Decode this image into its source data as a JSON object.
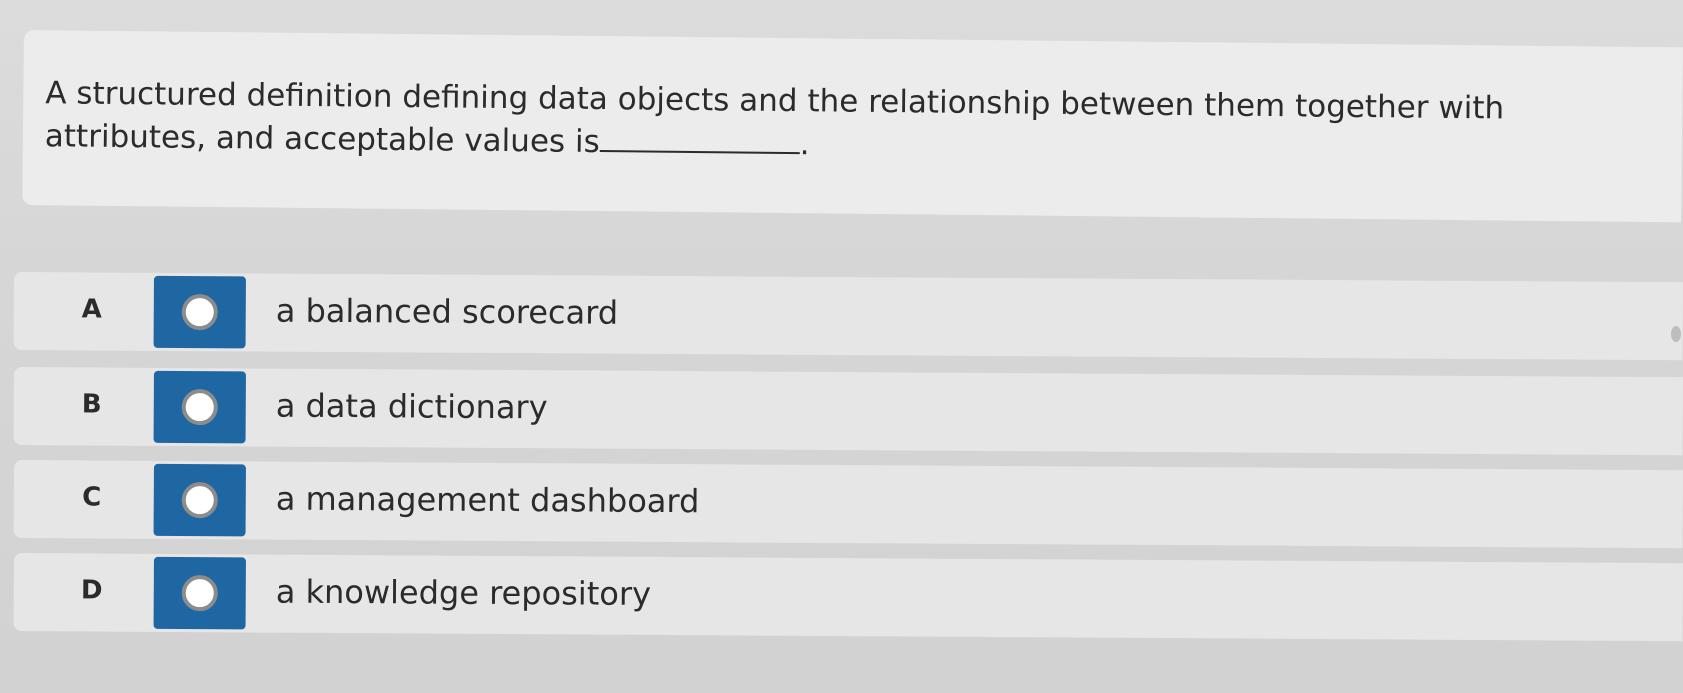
{
  "question": {
    "text": "A structured definition defining data objects and the relationship between them together with attributes, and acceptable values is",
    "suffix": "."
  },
  "options": [
    {
      "letter": "A",
      "text": "a balanced scorecard"
    },
    {
      "letter": "B",
      "text": "a data dictionary"
    },
    {
      "letter": "C",
      "text": "a management dashboard"
    },
    {
      "letter": "D",
      "text": "a knowledge repository"
    }
  ],
  "colors": {
    "radio_fill": "#1f67a3",
    "radio_ring": "#8c8c8c",
    "text": "#2b2b2b"
  },
  "icons": {
    "radio": "radio-unselected-icon"
  }
}
